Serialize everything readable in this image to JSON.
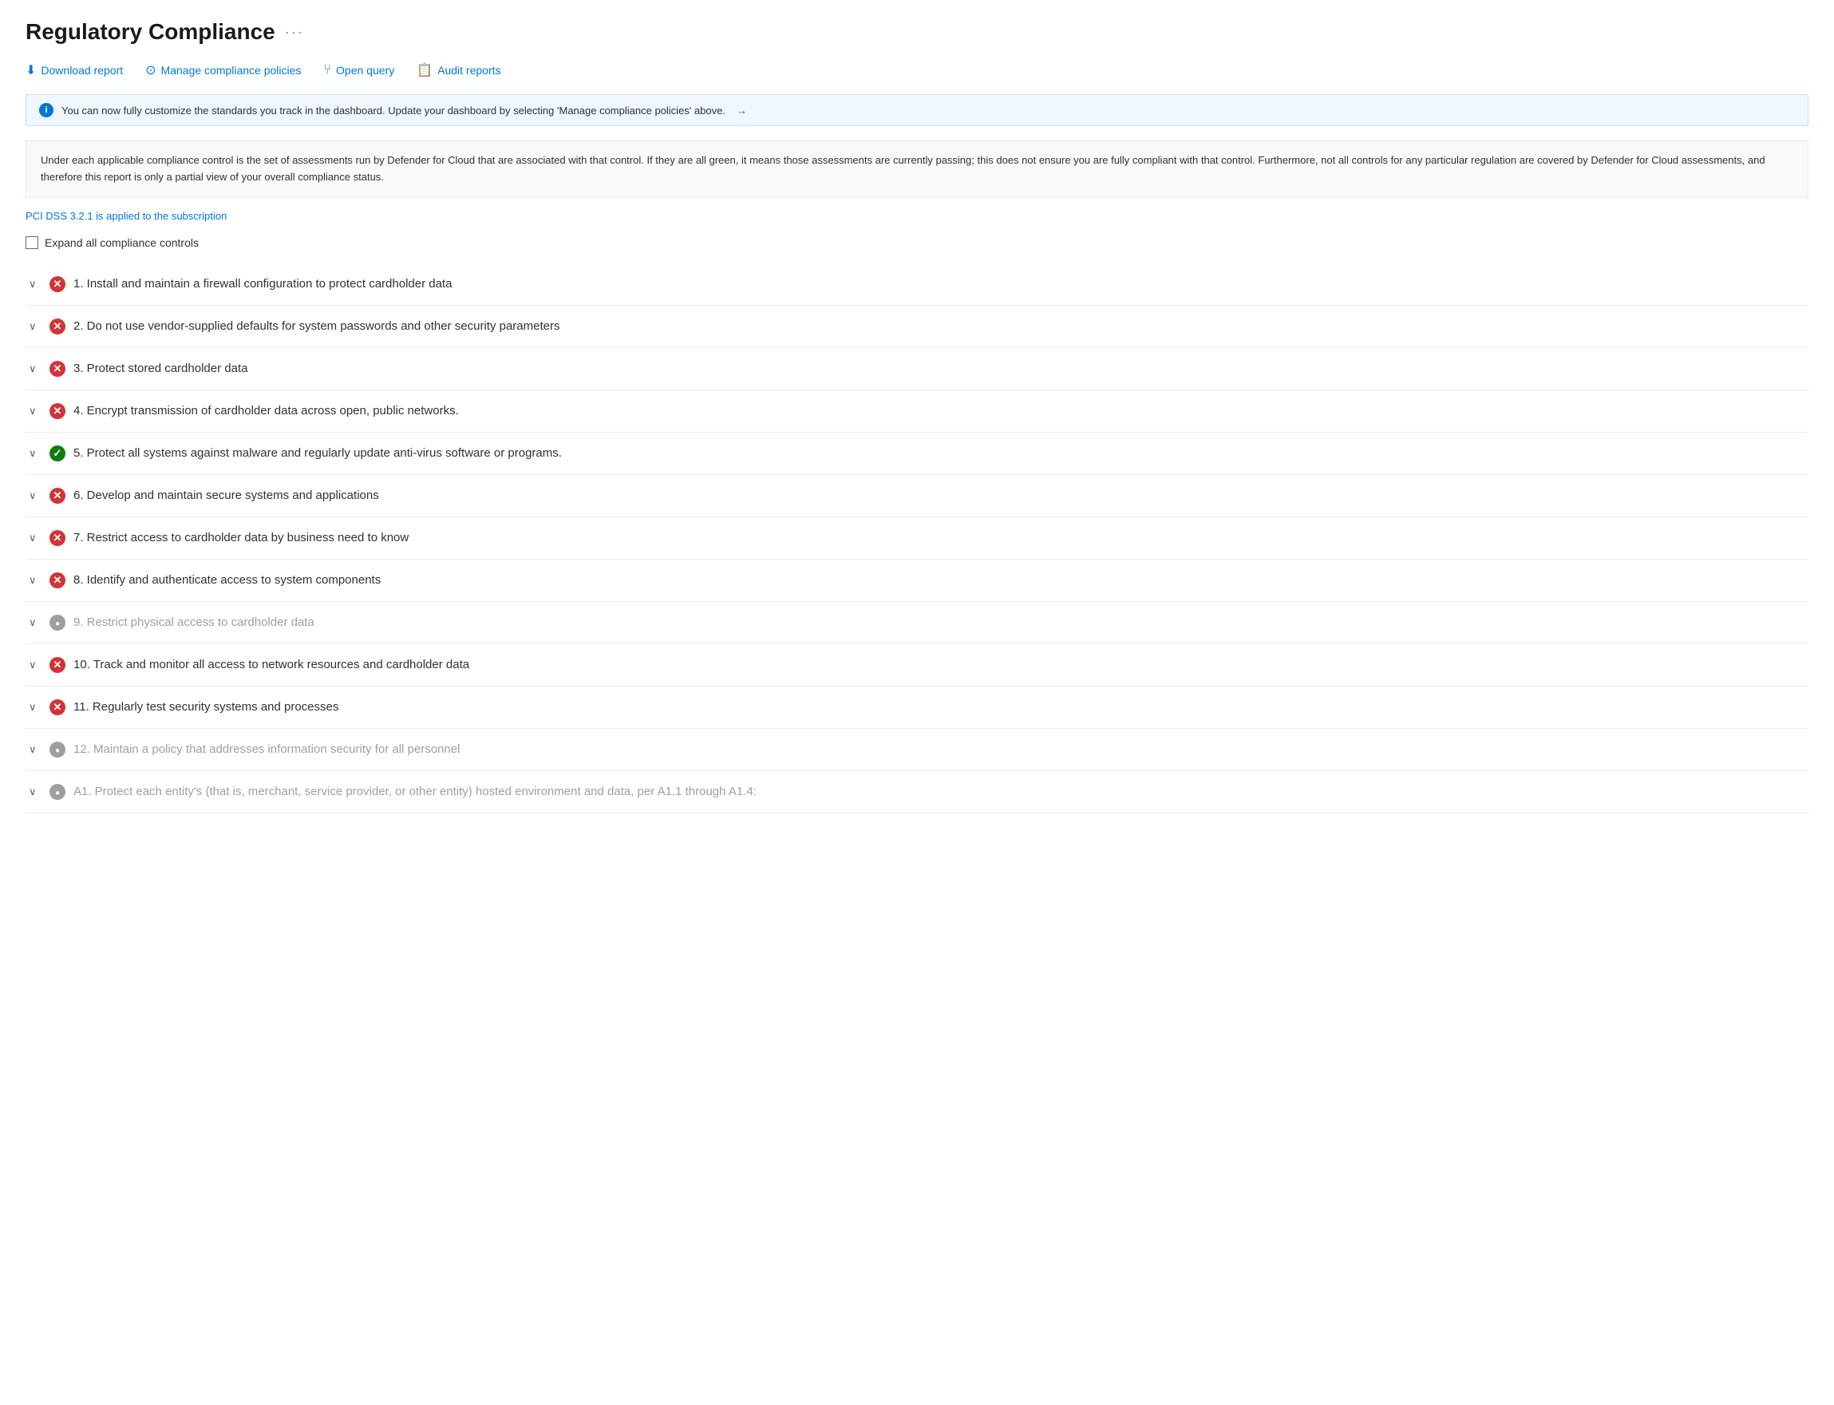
{
  "page": {
    "title": "Regulatory Compliance",
    "ellipsis": "···"
  },
  "toolbar": {
    "download_label": "Download report",
    "manage_label": "Manage compliance policies",
    "query_label": "Open query",
    "audit_label": "Audit reports"
  },
  "banner": {
    "text": "You can now fully customize the standards you track in the dashboard. Update your dashboard by selecting 'Manage compliance policies' above.",
    "arrow": "→"
  },
  "description": "Under each applicable compliance control is the set of assessments run by Defender for Cloud that are associated with that control. If they are all green, it means those assessments are currently passing; this does not ensure you are fully compliant with that control. Furthermore, not all controls for any particular regulation are covered by Defender for Cloud assessments, and therefore this report is only a partial view of your overall compliance status.",
  "pci_link": "PCI DSS 3.2.1 is applied to the subscription",
  "expand_all_label": "Expand all compliance controls",
  "items": [
    {
      "id": 1,
      "status": "red",
      "label": "1. Install and maintain a firewall configuration to protect cardholder data",
      "gray": false
    },
    {
      "id": 2,
      "status": "red",
      "label": "2. Do not use vendor-supplied defaults for system passwords and other security parameters",
      "gray": false
    },
    {
      "id": 3,
      "status": "red",
      "label": "3. Protect stored cardholder data",
      "gray": false
    },
    {
      "id": 4,
      "status": "red",
      "label": "4. Encrypt transmission of cardholder data across open, public networks.",
      "gray": false
    },
    {
      "id": 5,
      "status": "green",
      "label": "5. Protect all systems against malware and regularly update anti-virus software or programs.",
      "gray": false
    },
    {
      "id": 6,
      "status": "red",
      "label": "6. Develop and maintain secure systems and applications",
      "gray": false
    },
    {
      "id": 7,
      "status": "red",
      "label": "7. Restrict access to cardholder data by business need to know",
      "gray": false
    },
    {
      "id": 8,
      "status": "red",
      "label": "8. Identify and authenticate access to system components",
      "gray": false
    },
    {
      "id": 9,
      "status": "gray",
      "label": "9. Restrict physical access to cardholder data",
      "gray": true
    },
    {
      "id": 10,
      "status": "red",
      "label": "10. Track and monitor all access to network resources and cardholder data",
      "gray": false
    },
    {
      "id": 11,
      "status": "red",
      "label": "11. Regularly test security systems and processes",
      "gray": false
    },
    {
      "id": 12,
      "status": "gray",
      "label": "12. Maintain a policy that addresses information security for all personnel",
      "gray": true
    },
    {
      "id": 13,
      "status": "gray",
      "label": "A1. Protect each entity's (that is, merchant, service provider, or other entity) hosted environment and data, per A1.1 through A1.4:",
      "gray": true
    }
  ]
}
